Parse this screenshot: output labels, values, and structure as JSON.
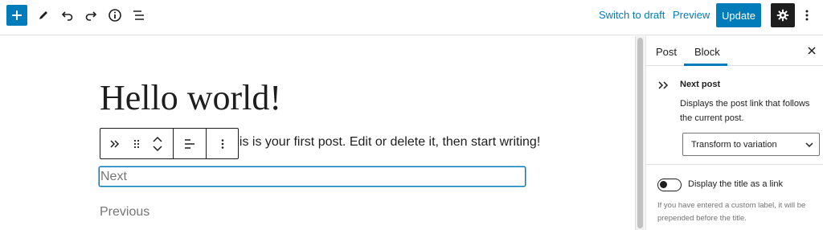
{
  "toolbar": {
    "add_icon": "plus-icon",
    "switch_to_draft": "Switch to draft",
    "preview": "Preview",
    "update": "Update"
  },
  "editor": {
    "title": "Hello world!",
    "paragraph": "his is your first post. Edit or delete it, then start writing!",
    "next_placeholder": "Next",
    "previous": "Previous"
  },
  "sidebar": {
    "tabs": [
      {
        "label": "Post"
      },
      {
        "label": "Block"
      }
    ],
    "active_tab": "Block",
    "block": {
      "title": "Next post",
      "description": "Displays the post link that follows the current post.",
      "transform_label": "Transform to variation"
    },
    "toggle_label": "Display the title as a link",
    "toggle_on": false,
    "help_text": "If you have entered a custom label, it will be prepended before the title."
  },
  "colors": {
    "accent": "#007cba",
    "dark": "#1e1e1e",
    "muted": "#757575"
  }
}
